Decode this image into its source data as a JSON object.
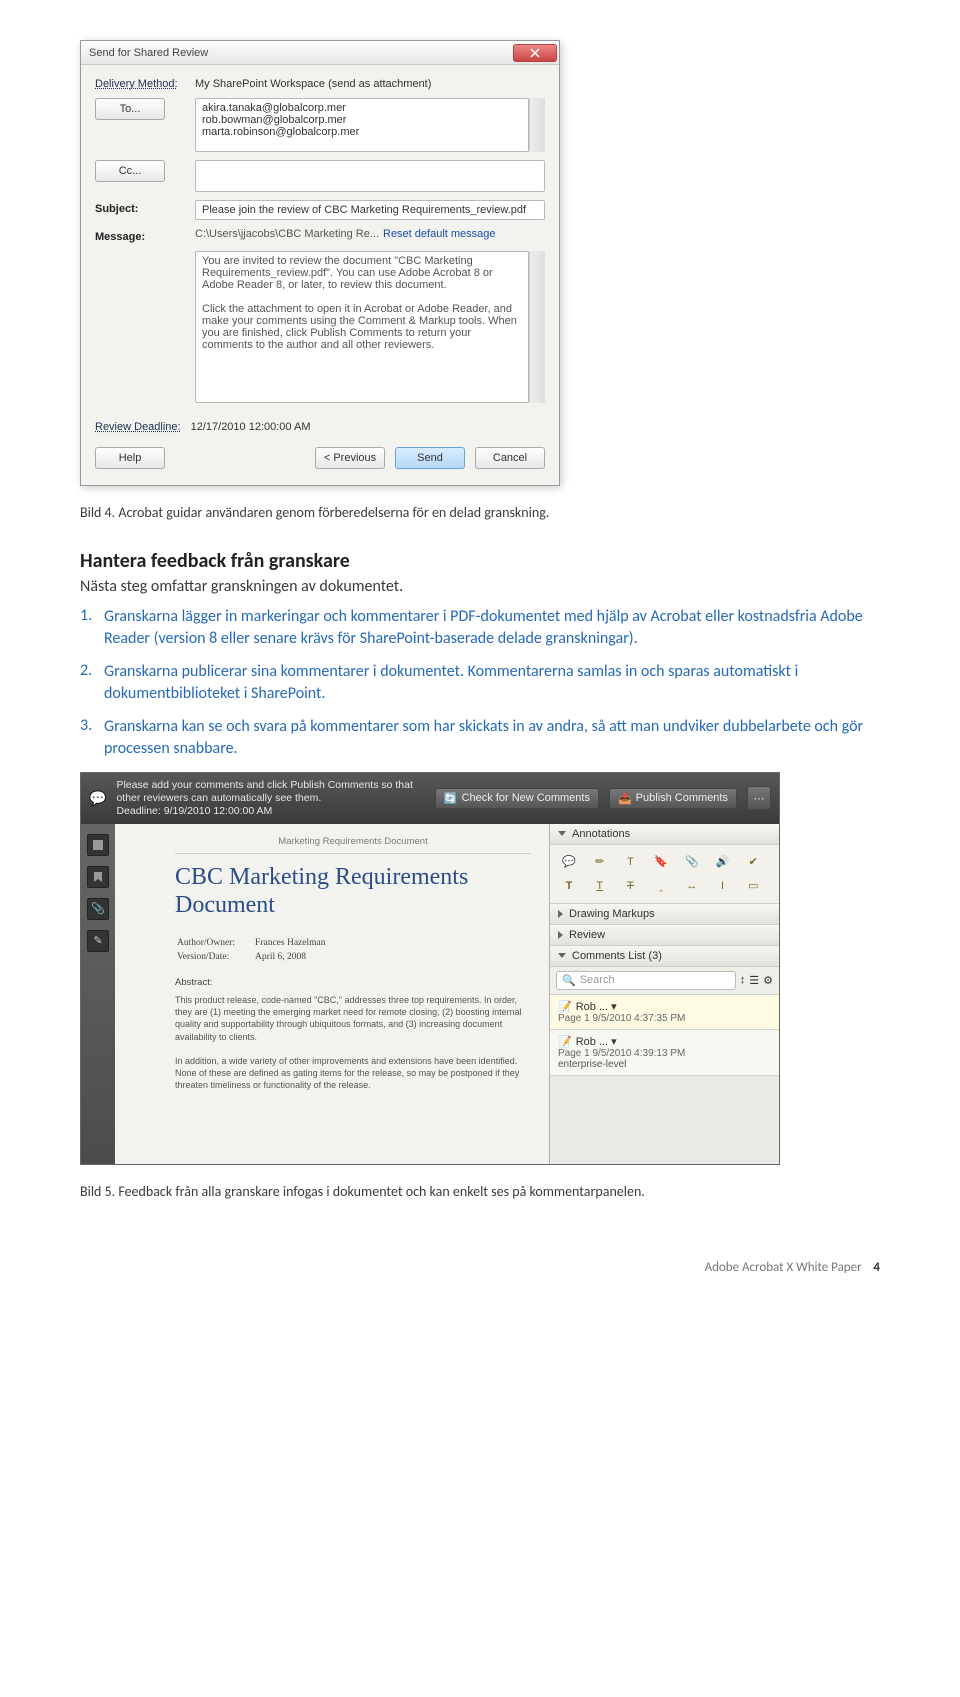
{
  "dialog": {
    "title": "Send for Shared Review",
    "delivery_label": "Delivery Method:",
    "delivery_value": "My SharePoint Workspace (send as attachment)",
    "to_btn": "To...",
    "to_value": "akira.tanaka@globalcorp.mer\nrob.bowman@globalcorp.mer\nmarta.robinson@globalcorp.mer",
    "cc_btn": "Cc...",
    "cc_value": "",
    "subject_label": "Subject:",
    "subject_value": "Please join the review of CBC Marketing Requirements_review.pdf",
    "message_label": "Message:",
    "message_path": "C:\\Users\\jjacobs\\CBC Marketing Re...",
    "reset_link": "Reset default message",
    "message_body": "You are invited to review the document \"CBC Marketing Requirements_review.pdf\". You can use Adobe Acrobat 8 or Adobe Reader 8, or later, to review this document.\n\nClick the attachment to open it in Acrobat or Adobe Reader, and make your comments using the Comment & Markup tools. When you are finished, click Publish Comments to return your comments to the author and all other reviewers.",
    "deadline_label": "Review Deadline:",
    "deadline_value": "12/17/2010 12:00:00 AM",
    "help_btn": "Help",
    "prev_btn": "< Previous",
    "send_btn": "Send",
    "cancel_btn": "Cancel"
  },
  "caption4": "Bild 4. Acrobat guidar användaren genom förberedelserna för en delad granskning.",
  "section": {
    "heading": "Hantera feedback från granskare",
    "intro": "Nästa steg omfattar granskningen av dokumentet.",
    "items": [
      {
        "num": "1.",
        "text": "Granskarna lägger in markeringar och kommentarer i PDF-dokumentet med hjälp av Acrobat eller kostnadsfria Adobe Reader (version 8 eller senare krävs för SharePoint-baserade delade granskningar)."
      },
      {
        "num": "2.",
        "text": "Granskarna publicerar sina kommentarer i dokumentet. Kommentarerna samlas in och sparas automatiskt i dokumentbiblioteket i SharePoint."
      },
      {
        "num": "3.",
        "text": "Granskarna kan se och svara på kommentarer som har skickats in av andra, så att man undviker dubbelarbete och gör processen snabbare."
      }
    ]
  },
  "editor": {
    "hint": "Please add your comments and click Publish Comments so that other reviewers can automatically see them.\nDeadline: 9/19/2010 12:00:00 AM",
    "btn_check": "Check for New Comments",
    "btn_publish": "Publish Comments",
    "doc_header": "Marketing Requirements Document",
    "doc_title": "CBC Marketing Requirements Document",
    "meta_author_label": "Author/Owner:",
    "meta_author": "Frances Hazelman",
    "meta_date_label": "Version/Date:",
    "meta_date": "April 6, 2008",
    "abstract_label": "Abstract:",
    "abstract_body": "This product release, code-named \"CBC,\" addresses three top requirements. In order, they are (1) meeting the emerging market need for remote closing, (2) boosting internal quality and supportability through ubiquitous formats, and (3) increasing document availability to clients.\n\nIn addition, a wide variety of other improvements and extensions have been identified. None of these are defined as gating items for the release, so may be postponed if they threaten timeliness or functionality of the release.",
    "panel_annotations": "Annotations",
    "panel_drawing": "Drawing Markups",
    "panel_review": "Review",
    "panel_comments": "Comments List (3)",
    "search_placeholder": "Search",
    "comment1_who": "Rob ... ▾",
    "comment1_meta": "Page 1  9/5/2010 4:37:35 PM",
    "comment2_who": "Rob ... ▾",
    "comment2_meta": "Page 1  9/5/2010 4:39:13 PM",
    "comment2_extra": "enterprise-level"
  },
  "caption5": "Bild 5. Feedback från alla granskare infogas i dokumentet och kan enkelt ses på kommentarpanelen.",
  "footer": {
    "product": "Adobe Acrobat X White Paper",
    "page": "4"
  }
}
